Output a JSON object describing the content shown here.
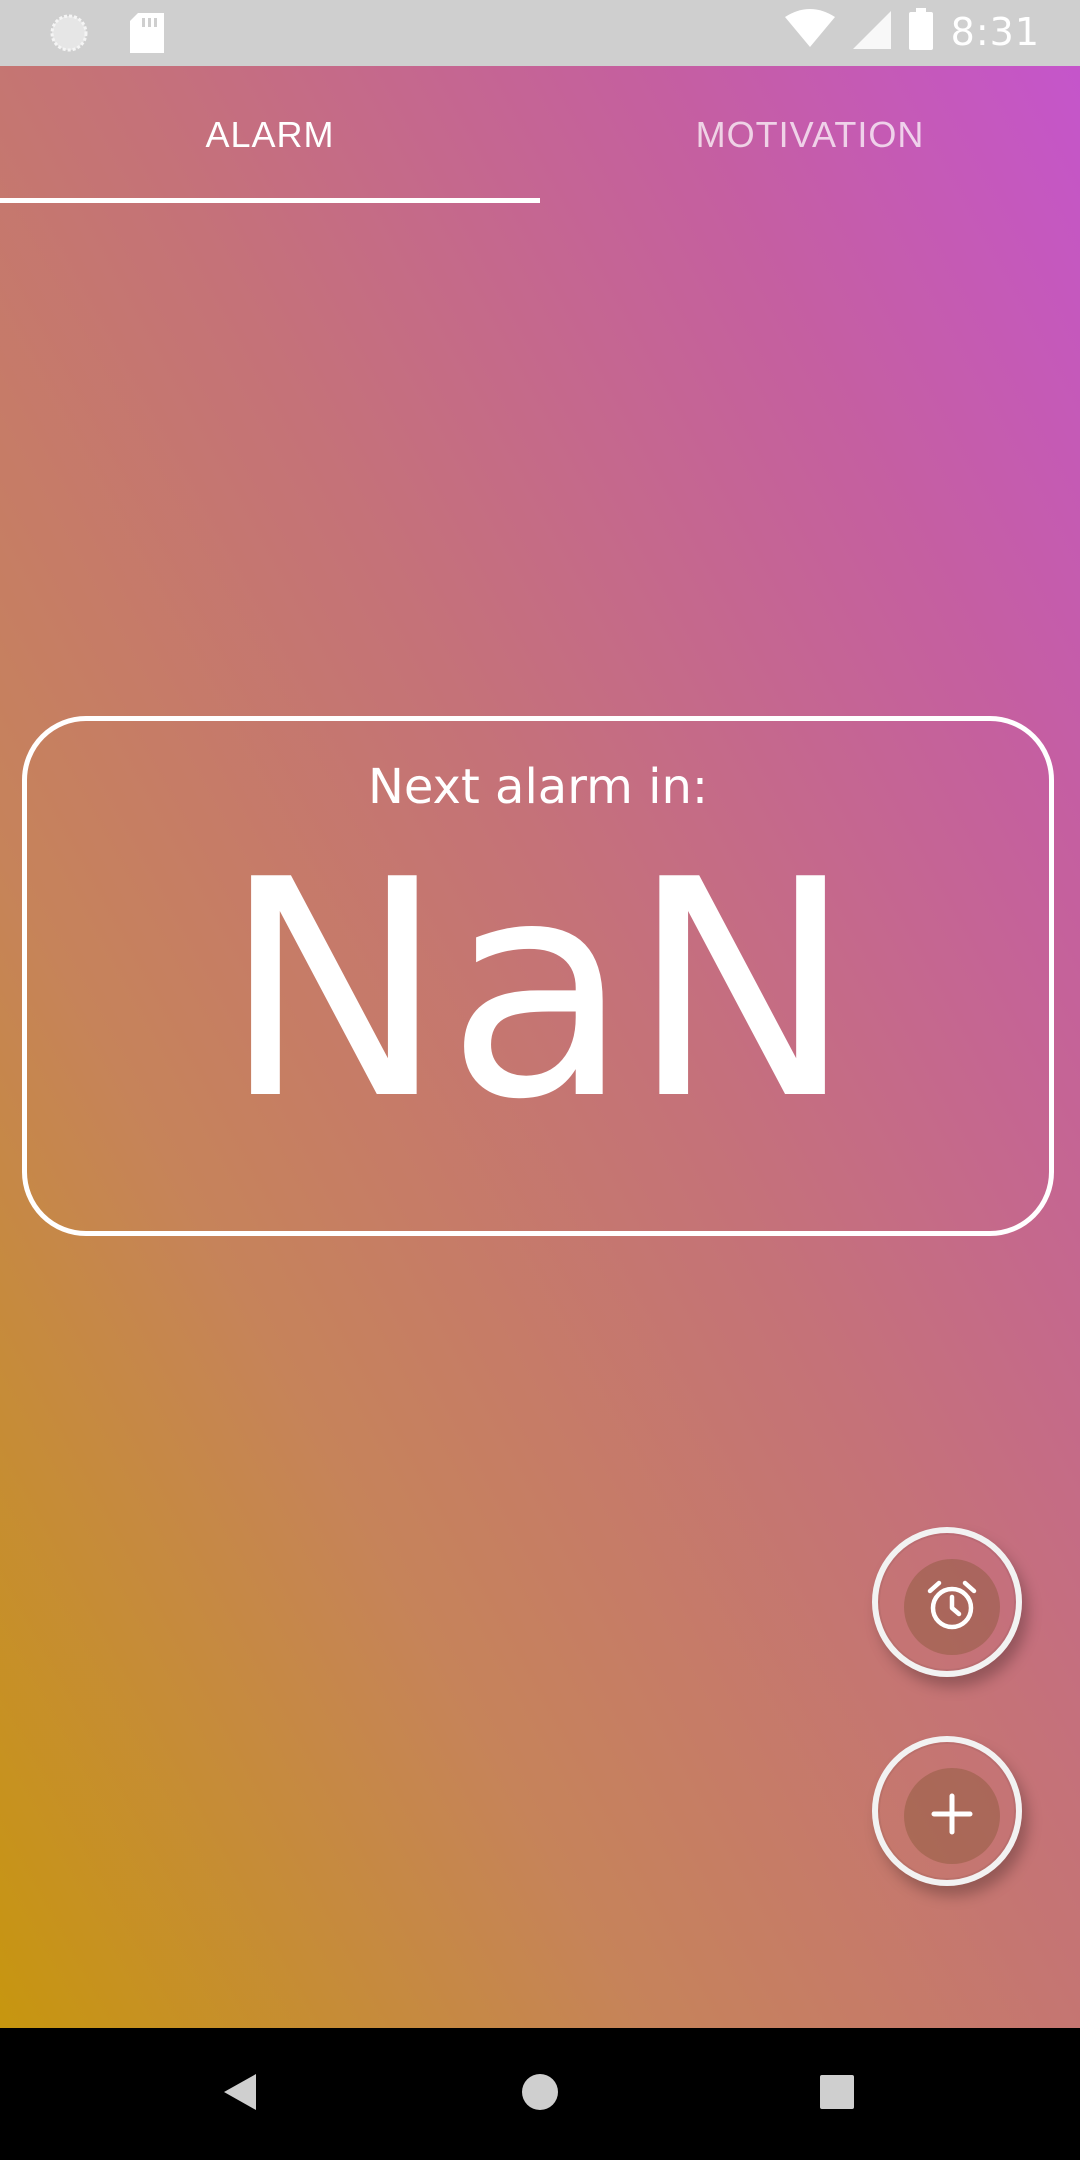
{
  "status_bar": {
    "time": "8:31",
    "icons": [
      "loading-circle-icon",
      "sd-card-icon",
      "wifi-icon",
      "cell-signal-icon",
      "battery-icon"
    ]
  },
  "tabs": [
    {
      "label": "ALARM",
      "active": true
    },
    {
      "label": "MOTIVATION",
      "active": false
    }
  ],
  "card": {
    "title": "Next alarm in:",
    "value": "NaN"
  },
  "fabs": {
    "alarm_icon": "alarm-clock-icon",
    "add_icon": "plus-icon"
  },
  "nav_bar": {
    "icons": [
      "back-icon",
      "home-icon",
      "recents-icon"
    ]
  },
  "colors": {
    "gradient_bottom_left": "#c7960f",
    "gradient_top_right": "#c555cb",
    "status_bar": "#cfcfcf",
    "foreground": "#ffffff"
  }
}
